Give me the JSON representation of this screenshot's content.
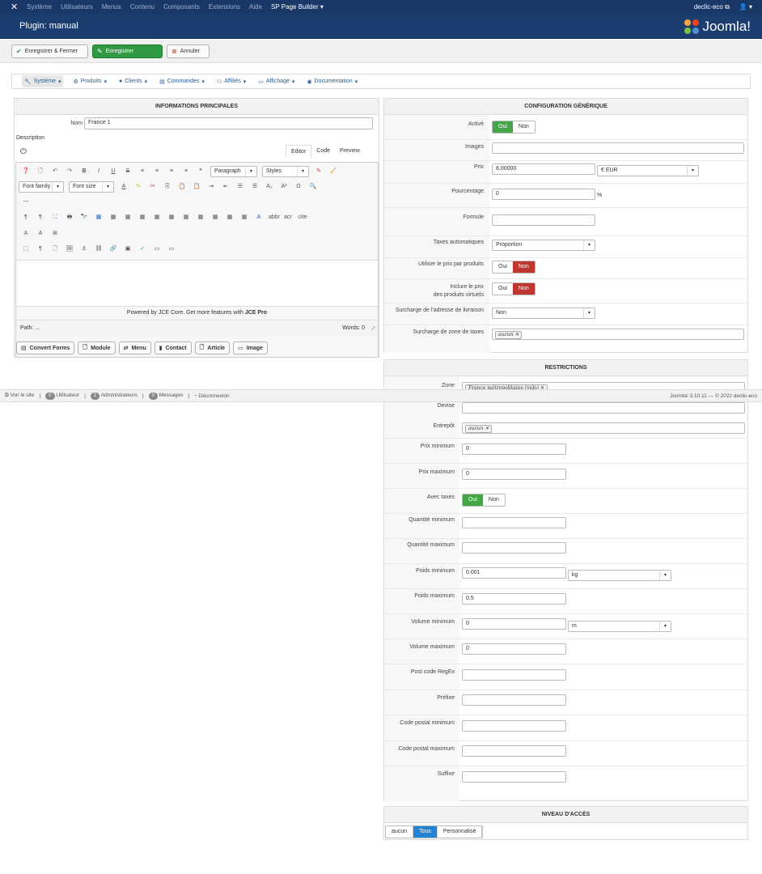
{
  "topbar": {
    "items": [
      "Système",
      "Utilisateurs",
      "Menus",
      "Contenu",
      "Composants",
      "Extensions",
      "Aide"
    ],
    "sp_builder": "SP Page Builder",
    "site": "declic-eco",
    "user": "👤"
  },
  "header": {
    "title": "Plugin: manual",
    "brand": "Joomla!"
  },
  "toolbar": {
    "save_close": "Enregistrer & Fermer",
    "save": "Enregistrer",
    "cancel": "Annuler"
  },
  "menu": [
    "Système",
    "Produits",
    "Clients",
    "Commandes",
    "Affiliés",
    "Affichage",
    "Documentation"
  ],
  "main": {
    "title": "INFORMATIONS PRINCIPALES",
    "name_label": "Nom",
    "name_value": "France 1",
    "description_label": "Description",
    "tabs": [
      "Editor",
      "Code",
      "Preview"
    ],
    "paragraph": "Paragraph",
    "styles": "Styles",
    "font_family": "Font family",
    "font_size": "Font size",
    "powered": "Powered by JCE Core. Get more features with",
    "powered_pro": "JCE Pro",
    "path": "Path: ...",
    "words": "Words: 0",
    "buttons": [
      "Convert Forms",
      "Module",
      "Menu",
      "Contact",
      "Article",
      "Image"
    ]
  },
  "config": {
    "title": "CONFIGURATION GÉNÉRIQUE",
    "active_label": "Activé",
    "yes": "Oui",
    "no": "Non",
    "images_label": "Images",
    "price_label": "Prix",
    "price_value": "8,00000",
    "currency": "€ EUR",
    "percent_label": "Pourcentage",
    "percent_value": "0",
    "percent_unit": "%",
    "formula_label": "Formule",
    "auto_tax_label": "Taxes automatiques",
    "auto_tax_value": "Proportion",
    "use_price_label": "Utiliser le prix par produits",
    "include_price_label_1": "Inclure le prix",
    "include_price_label_2": "des produits virtuels",
    "ship_override_label": "Surcharge de l'adresse de livraison",
    "ship_override_value": "Non",
    "tax_zone_label": "Surcharge de zone de taxes",
    "tax_zone_tag": "aucun"
  },
  "restrictions": {
    "title": "RESTRICTIONS",
    "zone_label": "Zone",
    "zone_tag": "France métropolitaine (velo)",
    "currency_label": "Devise",
    "warehouse_label": "Entrepôt",
    "warehouse_tag": "aucun",
    "min_price_label": "Prix minimum",
    "min_price": "0",
    "max_price_label": "Prix maximum",
    "max_price": "0",
    "with_tax_label": "Avec taxes",
    "min_qty_label": "Quantité minimum",
    "max_qty_label": "Quantité maximum",
    "min_weight_label": "Poids minimum",
    "min_weight": "0.001",
    "weight_unit": "kg",
    "max_weight_label": "Poids maximum",
    "max_weight": "0.5",
    "min_volume_label": "Volume minimum",
    "min_volume": "0",
    "volume_unit": "m",
    "max_volume_label": "Volume maximum",
    "max_volume": "0",
    "regex_label": "Post code RegEx",
    "prefix_label": "Préfixe",
    "min_postcode_label": "Code postal minimum",
    "max_postcode_label": "Code postal maximum",
    "suffix_label": "Suffixe"
  },
  "access": {
    "title": "NIVEAU D'ACCÈS",
    "options": [
      "aucun",
      "Tous",
      "Personnalisé"
    ]
  },
  "statusbar": {
    "view_site": "Voir le site",
    "users_count": "0",
    "users": "Utilisateur",
    "admins_count": "2",
    "admins": "Administrateurs",
    "messages_count": "0",
    "messages": "Messages",
    "logout": "Déconnexion",
    "version": "Joomla! 3.10.11 — © 2022 declic-eco"
  }
}
